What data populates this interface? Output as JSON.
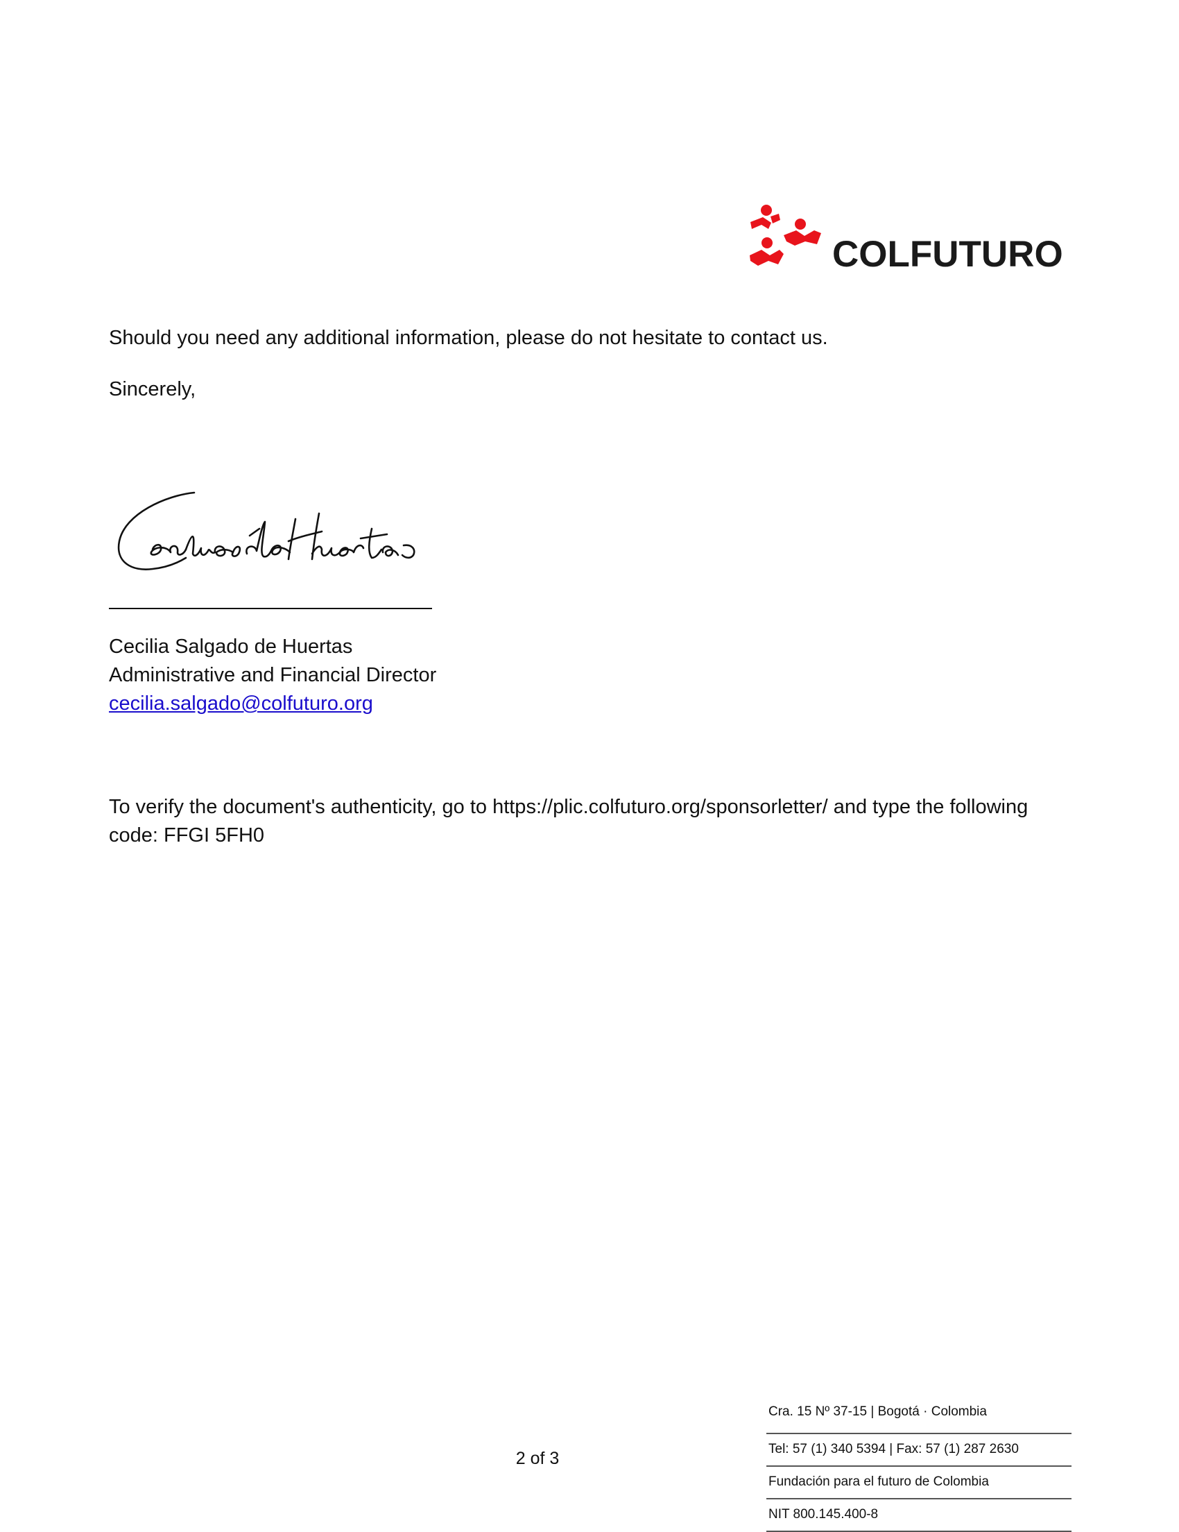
{
  "logo": {
    "text": "COLFUTURO",
    "icon": "colfuturo-readers-icon",
    "brand_color": "#e8141c"
  },
  "letter": {
    "contact_sentence": "Should you need any additional information, please do not hesitate to contact us.",
    "closing": "Sincerely,",
    "signature_line": "____________________________",
    "signer_name": "Cecilia Salgado de Huertas",
    "signer_title": "Administrative and Financial Director",
    "signer_email": "cecilia.salgado@colfuturo.org",
    "verification_text": "To verify the document's authenticity, go to https://plic.colfuturo.org/sponsorletter/ and type the following code: FFGI 5FH0"
  },
  "page_number": "2 of 3",
  "footer": {
    "address": "Cra. 15 Nº 37-15 | Bogotá · Colombia",
    "phones": "Tel: 57 (1) 340 5394 | Fax: 57 (1) 287 2630",
    "foundation": "Fundación para el futuro de Colombia",
    "nit": "NIT 800.145.400-8"
  },
  "colors": {
    "link": "#1a0dcc",
    "text": "#111111"
  }
}
